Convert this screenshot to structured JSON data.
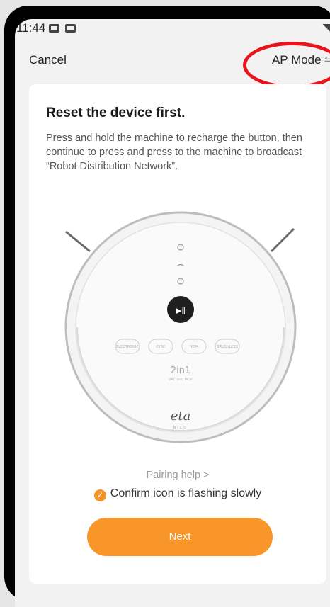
{
  "status_bar": {
    "time": "11:44"
  },
  "header": {
    "cancel_label": "Cancel",
    "ap_mode_label": "AP Mode",
    "swap_glyph": "⇋"
  },
  "card": {
    "title": "Reset the device first.",
    "description": "Press and hold the machine to recharge the button, then continue to press and press to the machine to broadcast “Robot Distribution Network”.",
    "robot": {
      "labels": [
        "ELECTRONIC",
        "CYBC",
        "HEPA",
        "BRUSHLESS"
      ],
      "model": "2in1",
      "model_sub": "VAC and MOP",
      "brand": "eta",
      "brand_sub": "NICO"
    },
    "pairing_help": "Pairing help >",
    "confirm_label": "Confirm icon is flashing slowly",
    "next_label": "Next"
  },
  "colors": {
    "accent": "#f8962a",
    "highlight": "#e8141c"
  }
}
